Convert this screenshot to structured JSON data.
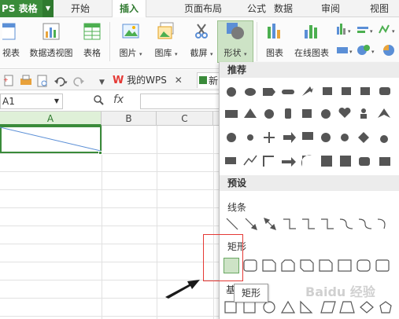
{
  "app": {
    "title": "PS 表格"
  },
  "menu": {
    "tabs": [
      "开始",
      "插入",
      "页面布局",
      "公式",
      "数据",
      "审阅",
      "视图"
    ],
    "active": "插入"
  },
  "ribbon": {
    "buttons": [
      "视表",
      "数据透视图",
      "表格",
      "图片",
      "图库",
      "截屏",
      "形状",
      "图表",
      "在线图表"
    ]
  },
  "quickbar": {
    "doc_tab_wps": "我的WPS",
    "doc_tab_new": "新"
  },
  "formula_bar": {
    "name_box": "A1",
    "fx": "fx"
  },
  "grid": {
    "columns": [
      "A",
      "B",
      "C"
    ]
  },
  "shapes_dropdown": {
    "recommended_header": "推荐",
    "presets_header": "预设",
    "lines_label": "线条",
    "rectangles_label": "矩形",
    "basic_label": "基"
  },
  "tooltip": {
    "text": "矩形"
  },
  "watermark": {
    "text": "Baidu 经验"
  },
  "colors": {
    "accent": "#3a8b3a",
    "highlight": "#e53935",
    "shape_gray": "#555555"
  }
}
